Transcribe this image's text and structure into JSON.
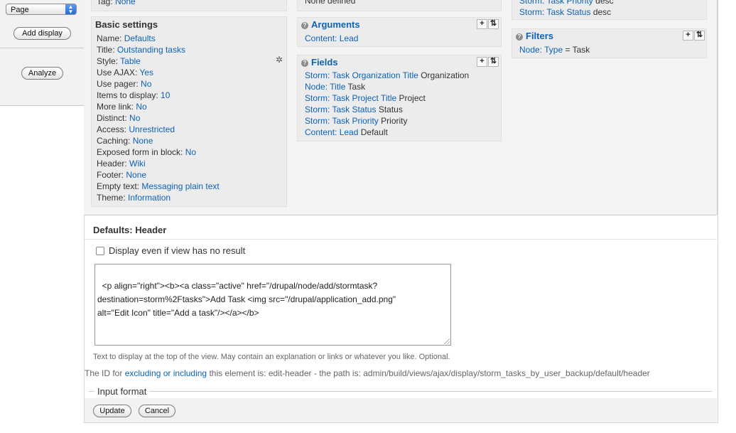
{
  "left_panel": {
    "display_select": "Page",
    "add_display_label": "Add display",
    "analyze_label": "Analyze"
  },
  "top_remnants": {
    "tag_label": "Tag:",
    "tag_value": "None",
    "none_defined": "None defined",
    "sort_row1_link": "Storm: Task Priority",
    "sort_row1_order": "desc",
    "sort_row2_link": "Storm: Task Status",
    "sort_row2_order": "desc"
  },
  "basic_settings": {
    "title": "Basic settings",
    "rows": [
      {
        "label": "Name:",
        "value": "Defaults"
      },
      {
        "label": "Title:",
        "value": "Outstanding tasks"
      },
      {
        "label": "Style:",
        "value": "Table"
      },
      {
        "label": "Use AJAX:",
        "value": "Yes"
      },
      {
        "label": "Use pager:",
        "value": "No"
      },
      {
        "label": "Items to display:",
        "value": "10"
      },
      {
        "label": "More link:",
        "value": "No"
      },
      {
        "label": "Distinct:",
        "value": "No"
      },
      {
        "label": "Access:",
        "value": "Unrestricted"
      },
      {
        "label": "Caching:",
        "value": "None"
      },
      {
        "label": "Exposed form in block:",
        "value": "No"
      },
      {
        "label": "Header:",
        "value": "Wiki"
      },
      {
        "label": "Footer:",
        "value": "None"
      },
      {
        "label": "Empty text:",
        "value": "Messaging plain text"
      },
      {
        "label": "Theme:",
        "value": "Information"
      }
    ]
  },
  "arguments": {
    "title": "Arguments",
    "items": [
      {
        "prefix": "Content:",
        "link": "Lead",
        "suffix": ""
      }
    ]
  },
  "fields": {
    "title": "Fields",
    "items": [
      {
        "link": "Storm: Task Organization Title",
        "suffix": "Organization"
      },
      {
        "link": "Node: Title",
        "suffix": "Task"
      },
      {
        "link": "Storm: Task Project Title",
        "suffix": "Project"
      },
      {
        "link": "Storm: Task Status",
        "suffix": "Status"
      },
      {
        "link": "Storm: Task Priority",
        "suffix": "Priority"
      },
      {
        "link": "Content: Lead",
        "suffix": "Default"
      }
    ]
  },
  "filters": {
    "title": "Filters",
    "item_link": "Node: Type",
    "item_suffix": "= Task"
  },
  "buttons": {
    "add": "+",
    "rearrange": "⇅"
  },
  "editor": {
    "title": "Defaults: Header",
    "checkbox_label": "Display even if view has no result",
    "textarea_value": "<p align=\"right\"><b><a class=\"active\" href=\"/drupal/node/add/stormtask?\ndestination=storm%2Ftasks\">Add Task <img src=\"/drupal/application_add.png\"\nalt=\"Edit Icon\" title=\"Add a task\"/></a></b>",
    "description": "Text to display at the top of the view. May contain an explanation or links or whatever you like. Optional.",
    "id_prefix": "The ID for",
    "id_link": "excluding or including",
    "id_suffix": "this element is: edit-header - the path is: admin/build/views/ajax/display/storm_tasks_by_user_backup/default/header",
    "input_format_label": "Input format",
    "update_label": "Update",
    "cancel_label": "Cancel"
  },
  "colors": {
    "link": "#0e62b6",
    "panel_bg": "#ececec"
  }
}
